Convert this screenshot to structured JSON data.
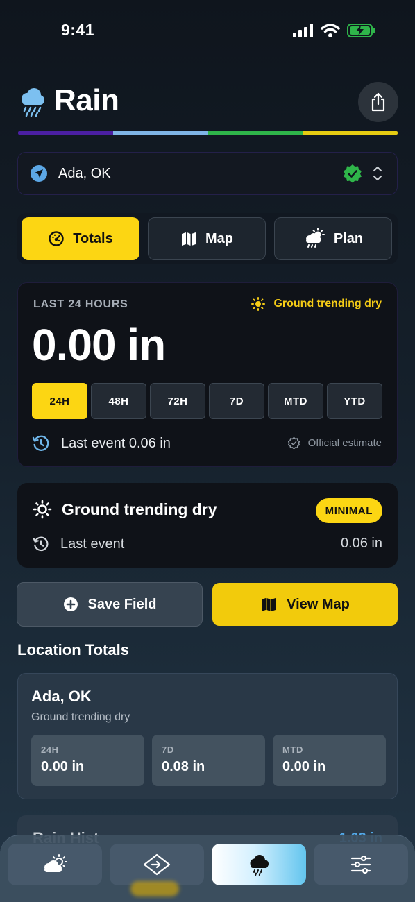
{
  "status_bar": {
    "time": "9:41"
  },
  "header": {
    "title": "Rain",
    "strip_colors": [
      "#4b1fa3",
      "#7fb5e6",
      "#2fb54a",
      "#e6cc12"
    ]
  },
  "location": {
    "name": "Ada, OK"
  },
  "tabs": [
    {
      "label": "Totals",
      "icon": "gauge-icon",
      "active": true
    },
    {
      "label": "Map",
      "icon": "map-icon",
      "active": false
    },
    {
      "label": "Plan",
      "icon": "sun-cloud-rain-icon",
      "active": false
    }
  ],
  "total_card": {
    "period_label": "LAST 24 HOURS",
    "trend_label": "Ground trending dry",
    "value": "0.00 in",
    "ranges": [
      "24H",
      "48H",
      "72H",
      "7D",
      "MTD",
      "YTD"
    ],
    "active_range": "24H",
    "last_event": "Last event 0.06 in",
    "estimate_label": "Official estimate"
  },
  "ground_card": {
    "title": "Ground trending dry",
    "badge": "MINIMAL",
    "last_event_label": "Last event",
    "last_event_value": "0.06 in"
  },
  "actions": {
    "save_label": "Save Field",
    "view_map_label": "View Map"
  },
  "location_totals": {
    "section_title": "Location Totals",
    "card": {
      "name": "Ada, OK",
      "subtitle": "Ground trending dry",
      "stats": [
        {
          "label": "24H",
          "value": "0.00 in"
        },
        {
          "label": "7D",
          "value": "0.08 in"
        },
        {
          "label": "MTD",
          "value": "0.00 in"
        }
      ]
    }
  },
  "history_card": {
    "title": "Rain Hist",
    "value": "1.03 in"
  },
  "tab_bar": {
    "items": [
      "weather-icon",
      "field-map-icon",
      "rain-icon",
      "sliders-icon"
    ],
    "active_index": 2
  },
  "colors": {
    "accent": "#fcd613",
    "verified": "#2fb54a",
    "info": "#5ca7e6"
  }
}
